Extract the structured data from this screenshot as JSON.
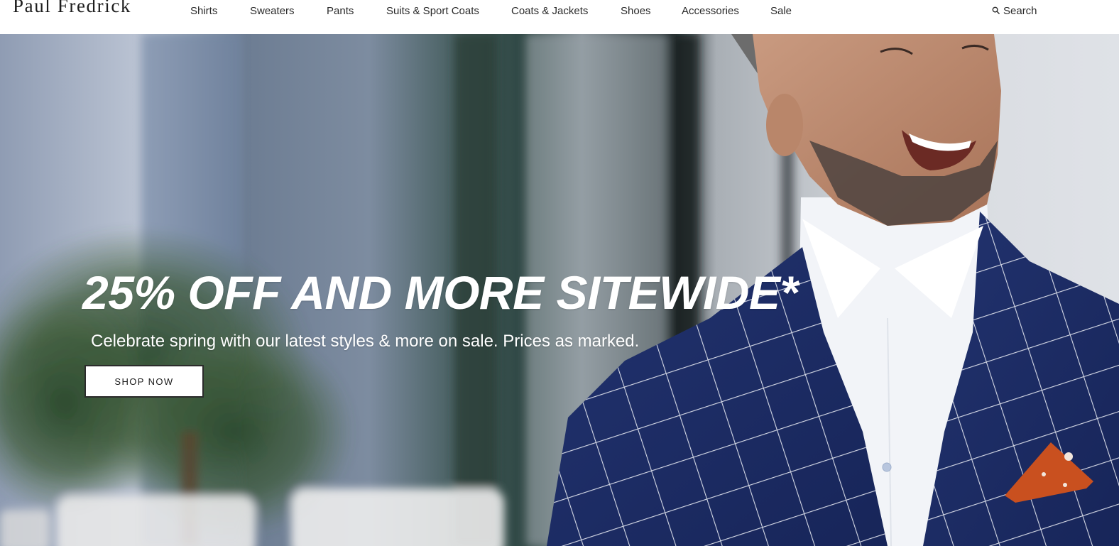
{
  "brand": {
    "logo_text": "Paul Fredrick"
  },
  "nav": {
    "items": [
      {
        "label": "Shirts"
      },
      {
        "label": "Sweaters"
      },
      {
        "label": "Pants"
      },
      {
        "label": "Suits & Sport Coats"
      },
      {
        "label": "Coats & Jackets"
      },
      {
        "label": "Shoes"
      },
      {
        "label": "Accessories"
      },
      {
        "label": "Sale"
      }
    ],
    "search_label": "Search",
    "search_icon": "search-icon"
  },
  "hero": {
    "headline": "25% OFF AND MORE SITEWIDE*",
    "subheadline": "Celebrate spring with our latest styles & more on sale. Prices as marked.",
    "cta_label": "SHOP NOW",
    "image_subject": "smiling man in navy windowpane sport coat with orange pocket square",
    "colors": {
      "jacket": "#1f2f6b",
      "pocket_square": "#c9501f",
      "shirt": "#f3f5f8",
      "text": "#ffffff"
    }
  }
}
